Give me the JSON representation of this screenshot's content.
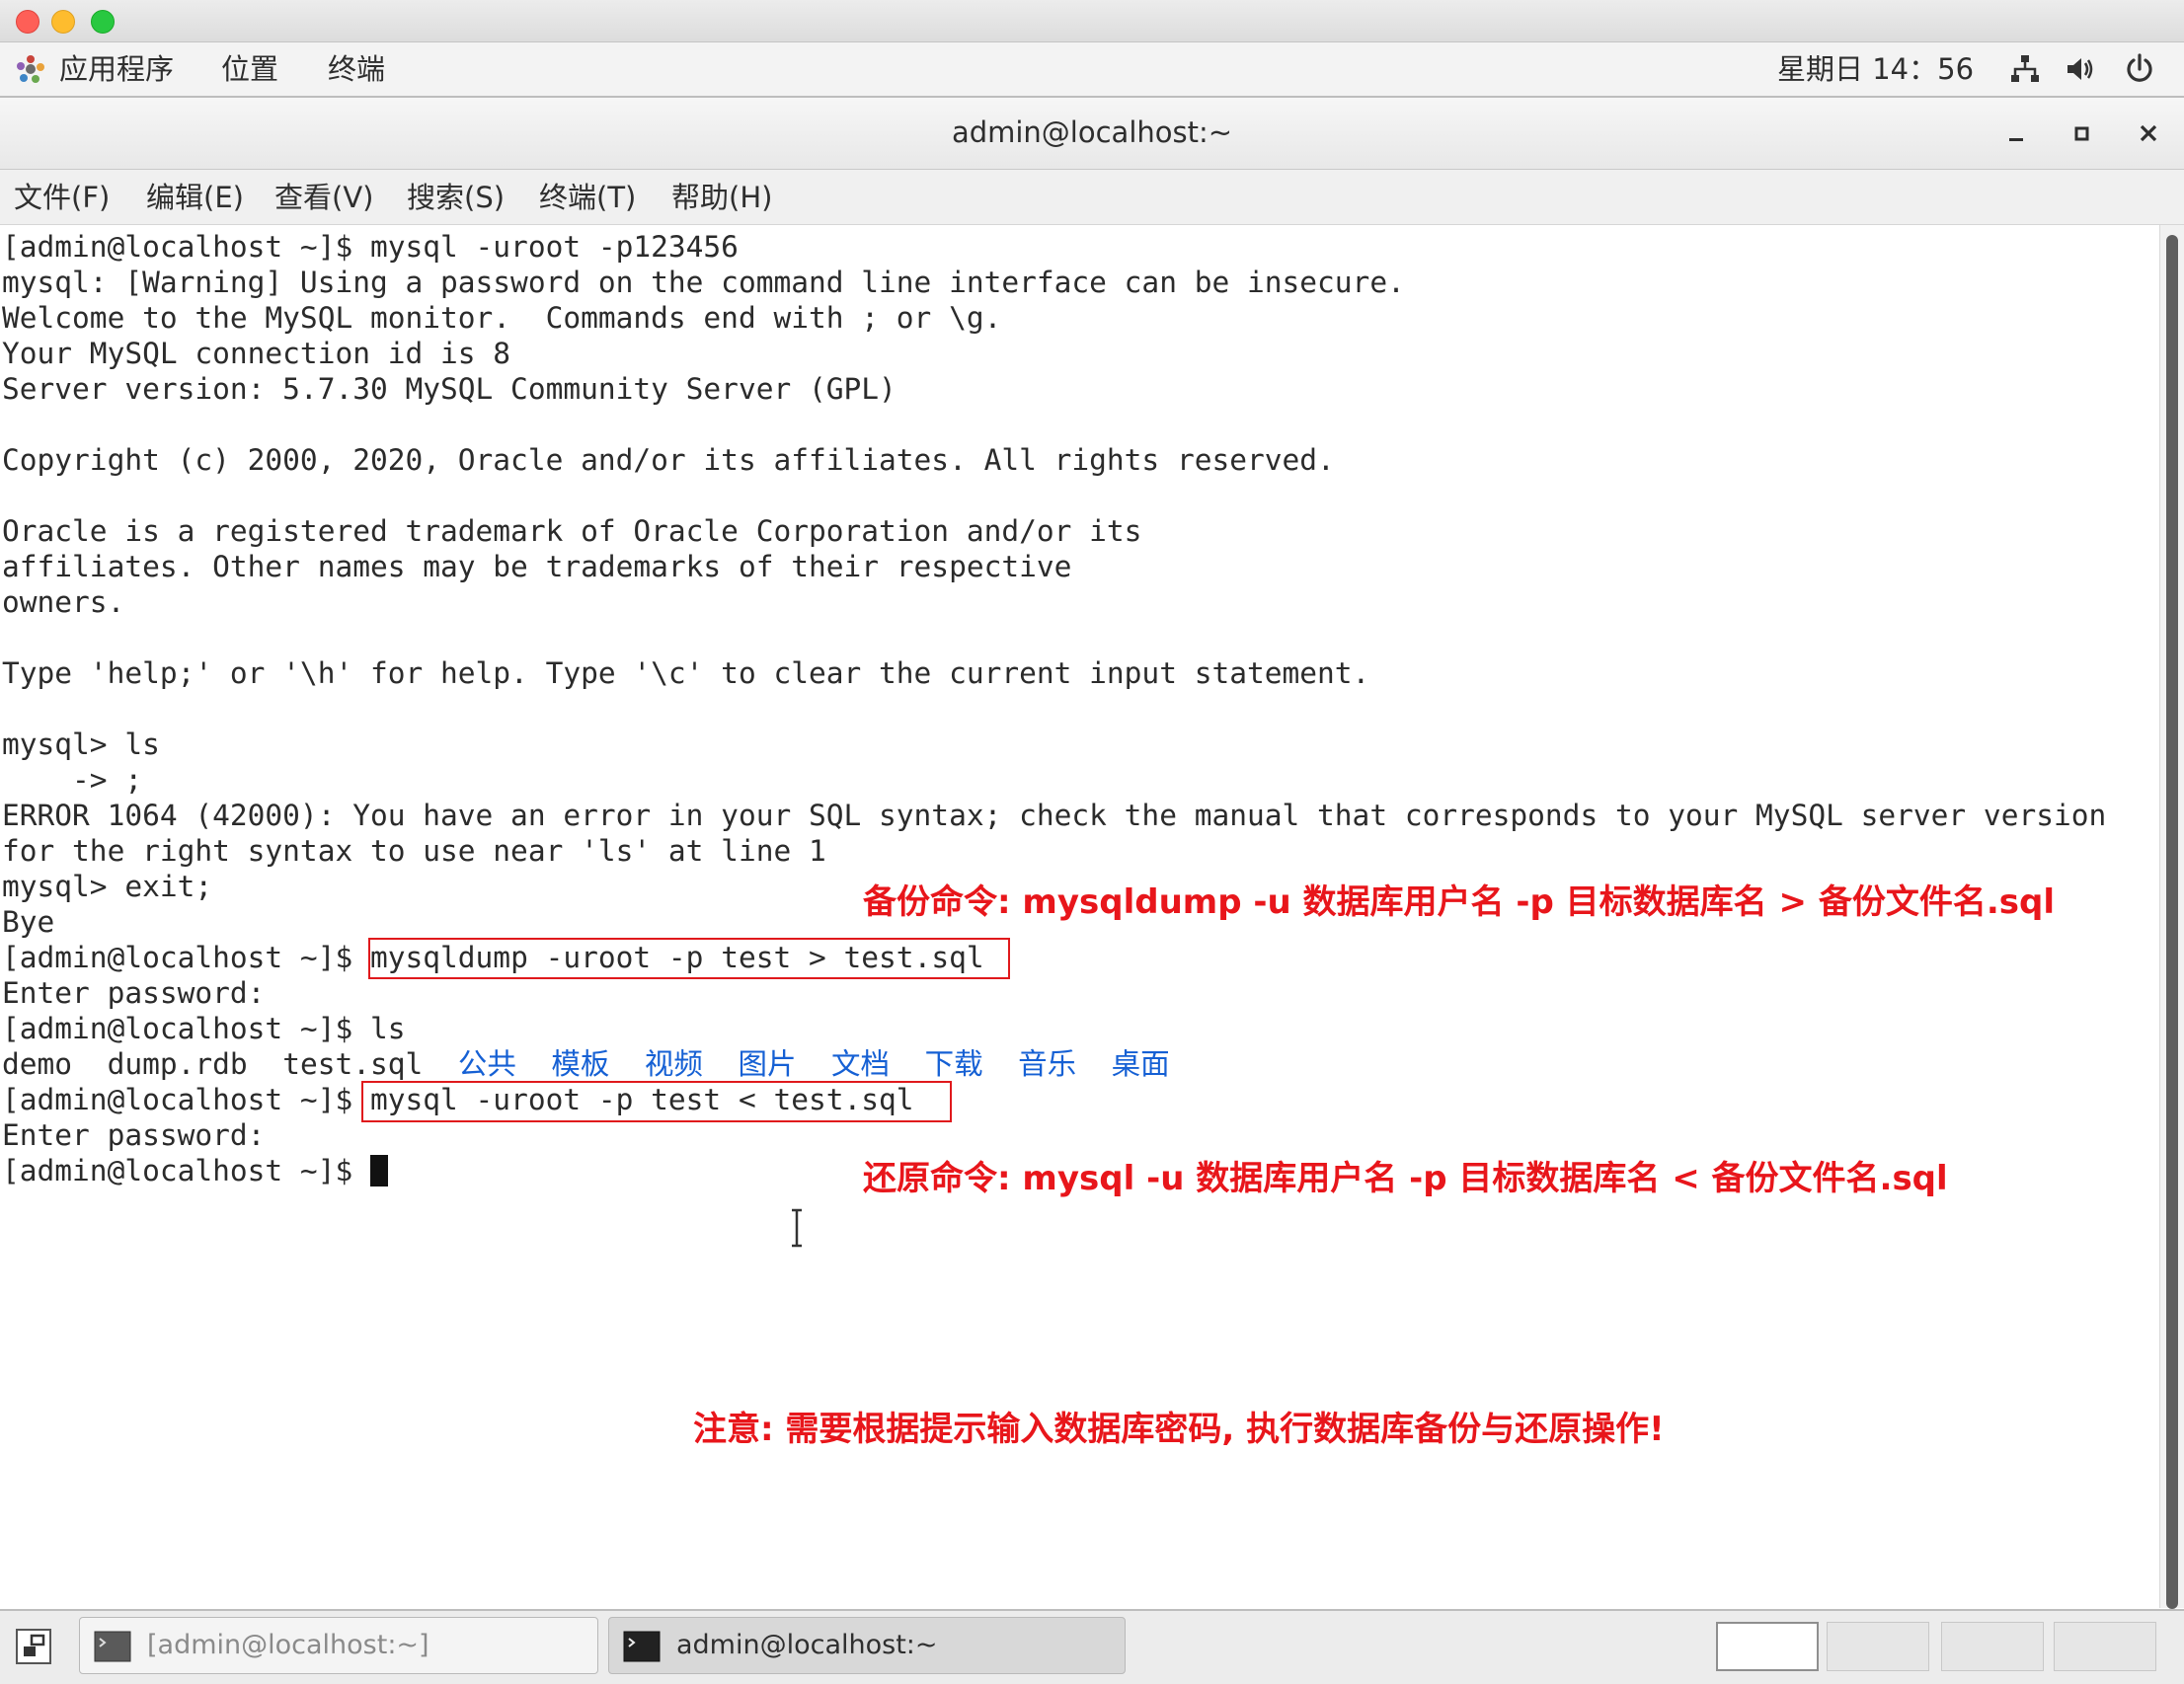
{
  "panel": {
    "menus": [
      "应用程序",
      "位置",
      "终端"
    ],
    "clock": "星期日 14：56",
    "tray_icons": [
      "network-icon",
      "volume-icon",
      "power-icon"
    ]
  },
  "window": {
    "title": "admin@localhost:~",
    "controls": [
      "minimize-icon",
      "maximize-icon",
      "close-icon"
    ]
  },
  "menubar": [
    "文件(F)",
    "编辑(E)",
    "查看(V)",
    "搜索(S)",
    "终端(T)",
    "帮助(H)"
  ],
  "terminal": {
    "lines": [
      "[admin@localhost ~]$ mysql -uroot -p123456",
      "mysql: [Warning] Using a password on the command line interface can be insecure.",
      "Welcome to the MySQL monitor.  Commands end with ; or \\g.",
      "Your MySQL connection id is 8",
      "Server version: 5.7.30 MySQL Community Server (GPL)",
      "",
      "Copyright (c) 2000, 2020, Oracle and/or its affiliates. All rights reserved.",
      "",
      "Oracle is a registered trademark of Oracle Corporation and/or its",
      "affiliates. Other names may be trademarks of their respective",
      "owners.",
      "",
      "Type 'help;' or '\\h' for help. Type '\\c' to clear the current input statement.",
      "",
      "mysql> ls",
      "    -> ;",
      "ERROR 1064 (42000): You have an error in your SQL syntax; check the manual that corresponds to your MySQL server version",
      "for the right syntax to use near 'ls' at line 1",
      "mysql> exit;",
      "Bye"
    ],
    "prompt": "[admin@localhost ~]$ ",
    "dump_command": "mysqldump -uroot -p test > test.sql",
    "enter_password": "Enter password:",
    "ls_command": "ls",
    "ls_files": [
      "demo",
      "dump.rdb",
      "test.sql"
    ],
    "ls_dirs": [
      "公共",
      "模板",
      "视频",
      "图片",
      "文档",
      "下载",
      "音乐",
      "桌面"
    ],
    "restore_command": "mysql -uroot -p test < test.sql"
  },
  "annotations": {
    "backup": "备份命令: mysqldump -u 数据库用户名 -p 目标数据库名 > 备份文件名.sql",
    "restore": "还原命令: mysql -u 数据库用户名 -p 目标数据库名 < 备份文件名.sql",
    "note": "注意: 需要根据提示输入数据库密码, 执行数据库备份与还原操作!"
  },
  "taskbar": {
    "tasks": [
      "[admin@localhost:~]",
      "admin@localhost:~"
    ],
    "workspaces": 4
  },
  "colors": {
    "annotation_red": "#e8161b",
    "directory_blue": "#1560d4"
  }
}
